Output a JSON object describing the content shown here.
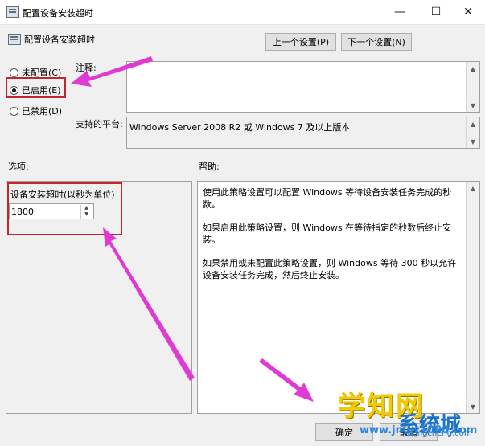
{
  "window": {
    "title": "配置设备安装超时",
    "minimize": "—",
    "maximize": "☐",
    "close": "✕"
  },
  "header": {
    "title": "配置设备安装超时",
    "prev_button": "上一个设置(P)",
    "next_button": "下一个设置(N)"
  },
  "radios": [
    {
      "label": "未配置(C)",
      "checked": false
    },
    {
      "label": "已启用(E)",
      "checked": true
    },
    {
      "label": "已禁用(D)",
      "checked": false
    }
  ],
  "comment": {
    "label": "注释:",
    "value": ""
  },
  "platform": {
    "label": "支持的平台:",
    "value": "Windows Server 2008 R2 或 Windows 7 及以上版本"
  },
  "options": {
    "label": "选项:",
    "field_label": "设备安装超时(以秒为单位)",
    "field_value": "1800"
  },
  "help": {
    "label": "帮助:",
    "paragraphs": [
      "使用此策略设置可以配置 Windows 等待设备安装任务完成的秒数。",
      "如果启用此策略设置，则 Windows 在等待指定的秒数后终止安装。",
      "如果禁用或未配置此策略设置，则 Windows 等待 300 秒以允许设备安装任务完成，然后终止安装。"
    ]
  },
  "footer": {
    "ok_button": "确定",
    "cancel_button": "取消"
  },
  "watermark": {
    "brand_cn": "学知网",
    "brand_sub": "系统城",
    "site": "www.jmqz1000.com",
    "url": "xitongcheng.com"
  },
  "colors": {
    "annotation_arrow": "#e03ad4",
    "highlight_box": "#c0262d"
  }
}
